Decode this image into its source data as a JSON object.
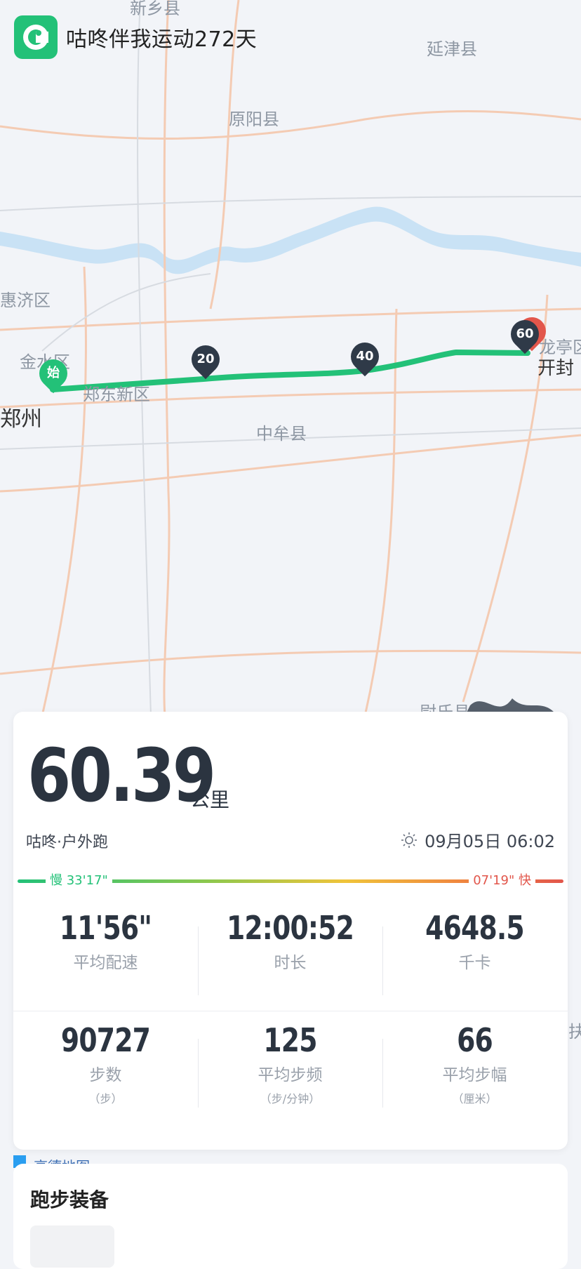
{
  "header": {
    "title": "咕咚伴我运动272天",
    "logo_icon": "codoon-logo-icon"
  },
  "map": {
    "labels": [
      "新乡县",
      "延津县",
      "原阳县",
      "惠济区",
      "金水区",
      "郑东新区",
      "中牟县",
      "龙亭区",
      "尉氏县",
      "扶"
    ],
    "cities": [
      "郑州",
      "开封"
    ],
    "start_marker": "始",
    "km_markers": [
      "20",
      "40",
      "60"
    ],
    "route_color": "#23c178",
    "attribution": "高德地图"
  },
  "summary": {
    "distance": "60.39",
    "distance_unit": "公里",
    "sport_type": "咕咚·户外跑",
    "weather_icon": "sun-icon",
    "datetime": "09月05日 06:02",
    "pace_slow": "慢 33'17\"",
    "pace_fast": "07'19\" 快"
  },
  "stats": [
    {
      "value": "11'56\"",
      "label": "平均配速",
      "unit": ""
    },
    {
      "value": "12:00:52",
      "label": "时长",
      "unit": ""
    },
    {
      "value": "4648.5",
      "label": "千卡",
      "unit": ""
    },
    {
      "value": "90727",
      "label": "步数",
      "unit": "（步）"
    },
    {
      "value": "125",
      "label": "平均步频",
      "unit": "（步/分钟）"
    },
    {
      "value": "66",
      "label": "平均步幅",
      "unit": "（厘米）"
    }
  ],
  "equipment": {
    "title": "跑步装备"
  },
  "colors": {
    "accent": "#23c178",
    "fast": "#e2564b",
    "text": "#2b3440"
  }
}
